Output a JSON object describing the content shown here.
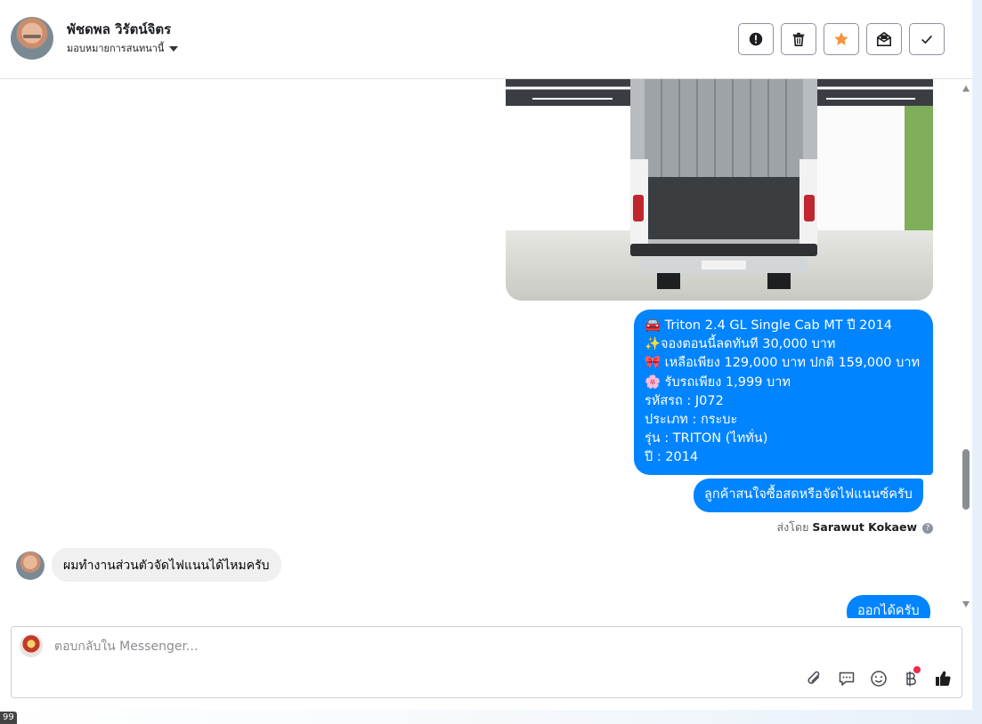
{
  "header": {
    "contact_name": "พัชดพล วิรัตน์จิตร",
    "assign_label": "มอบหมายการสนทนานี้",
    "actions": [
      {
        "name": "alert-icon"
      },
      {
        "name": "trash-icon"
      },
      {
        "name": "star-icon",
        "color": "#f7923a"
      },
      {
        "name": "mail-icon"
      },
      {
        "name": "check-icon"
      }
    ]
  },
  "messages": {
    "listing_lines": [
      "🚘 Triton 2.4 GL Single Cab MT ปี 2014",
      "✨จองตอนนี้ลดทันที 30,000 บาท",
      "🎀 เหลือเพียง 129,000 บาท ปกติ 159,000 บาท",
      "🌸 รับรถเพียง 1,999 บาท",
      "รหัสรถ : J072",
      "ประเภท : กระบะ",
      "รุ่น : TRITON (ไททั่น)",
      "ปี : 2014"
    ],
    "question": "ลูกค้าสนใจซื้อสดหรือจัดไฟแนนซ์ครับ",
    "sent_by_prefix": "ส่งโดย",
    "sent_by_name": "Sarawut Kokaew",
    "incoming": "ผมทำงานส่วนตัวจัดไฟแนนได้ไหมครับ",
    "last_reply": "ออกได้ครับ"
  },
  "composer": {
    "placeholder": "ตอบกลับใน Messenger..."
  },
  "corner_badge": "99",
  "colors": {
    "accent": "#0084ff",
    "incoming_bubble": "#f0f0f0",
    "star": "#f7923a"
  }
}
